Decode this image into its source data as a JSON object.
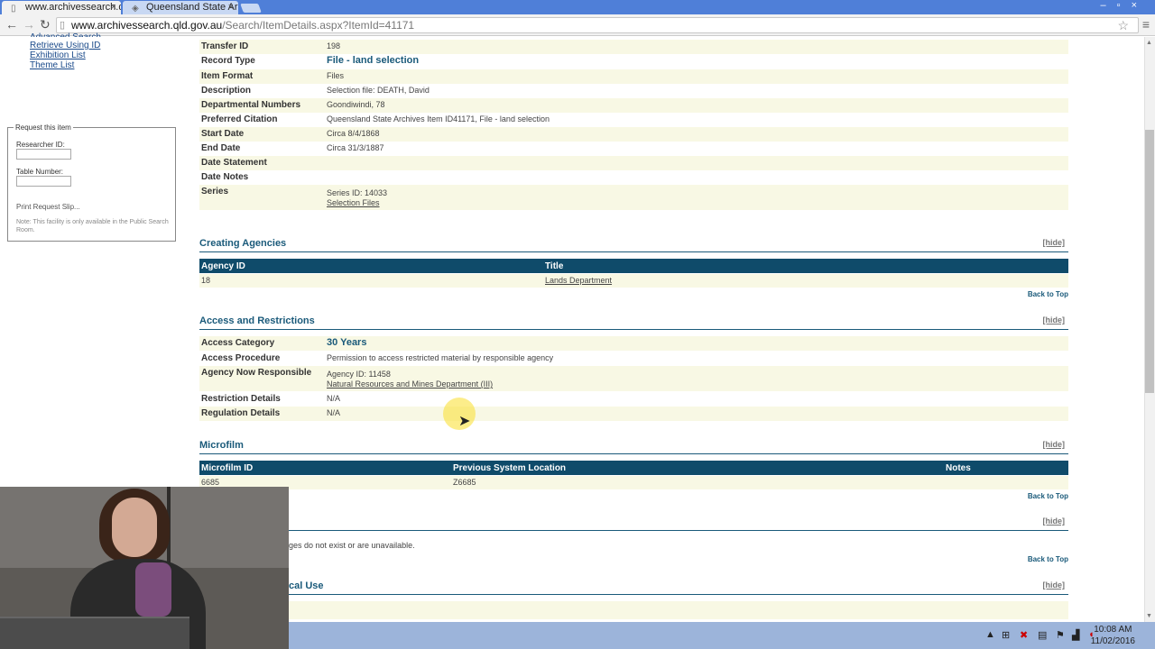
{
  "browser": {
    "tabs": [
      {
        "label": "www.archivessearch.q",
        "close": "×"
      },
      {
        "label": "Queensland State Arc",
        "close": "×"
      }
    ],
    "address": {
      "host": "www.archivessearch.qld.gov.au",
      "path": "/Search/ItemDetails.aspx?ItemId=41171"
    }
  },
  "left_nav": {
    "links": [
      "Advanced Search",
      "Retrieve Using ID",
      "Exhibition List",
      "Theme List"
    ],
    "request_box": {
      "legend": "Request this item",
      "researcher_label": "Researcher ID:",
      "table_label": "Table Number:",
      "print_link": "Print Request Slip...",
      "note": "Note: This facility is only available in the Public Search Room."
    }
  },
  "item": {
    "rows": [
      {
        "label": "Transfer ID",
        "value": "198"
      },
      {
        "label": "Record Type",
        "value": "File - land selection"
      },
      {
        "label": "Item Format",
        "value": "Files"
      },
      {
        "label": "Description",
        "value": "Selection file: DEATH, David"
      },
      {
        "label": "Departmental Numbers",
        "value": "Goondiwindi, 78"
      },
      {
        "label": "Preferred Citation",
        "value": "Queensland State Archives Item ID41171, File - land selection"
      },
      {
        "label": "Start Date",
        "value": "Circa 8/4/1868"
      },
      {
        "label": "End Date",
        "value": "Circa 31/3/1887"
      },
      {
        "label": "Date Statement",
        "value": ""
      },
      {
        "label": "Date Notes",
        "value": ""
      },
      {
        "label": "Series",
        "value": "Series ID: 14033",
        "link": "Selection Files"
      }
    ]
  },
  "creating_agencies": {
    "title": "Creating Agencies",
    "hide": "[hide]",
    "columns": [
      "Agency ID",
      "Title"
    ],
    "row": {
      "id": "18",
      "title": "Lands Department"
    },
    "back_to_top": "Back to Top"
  },
  "access": {
    "title": "Access and Restrictions",
    "hide": "[hide]",
    "rows": [
      {
        "label": "Access Category",
        "value": "30 Years"
      },
      {
        "label": "Access Procedure",
        "value": "Permission to access restricted material by responsible agency"
      },
      {
        "label": "Agency Now Responsible",
        "value": "Agency ID: 11458",
        "link": "Natural Resources and Mines Department (III)"
      },
      {
        "label": "Restriction Details",
        "value": "N/A"
      },
      {
        "label": "Regulation Details",
        "value": "N/A"
      }
    ]
  },
  "microfilm": {
    "title": "Microfilm",
    "hide": "[hide]",
    "columns": [
      "Microfilm ID",
      "Previous System Location",
      "Notes"
    ],
    "row": {
      "id": "6685",
      "location": "Z6685",
      "notes": ""
    },
    "back_to_top": "Back to Top"
  },
  "images_section": {
    "hide": "[hide]",
    "message": "ges do not exist or are unavailable.",
    "back_to_top": "Back to Top"
  },
  "local_use_section": {
    "title": "cal Use",
    "hide": "[hide]"
  },
  "taskbar": {
    "time": "10:08 AM",
    "date": "11/02/2016"
  }
}
